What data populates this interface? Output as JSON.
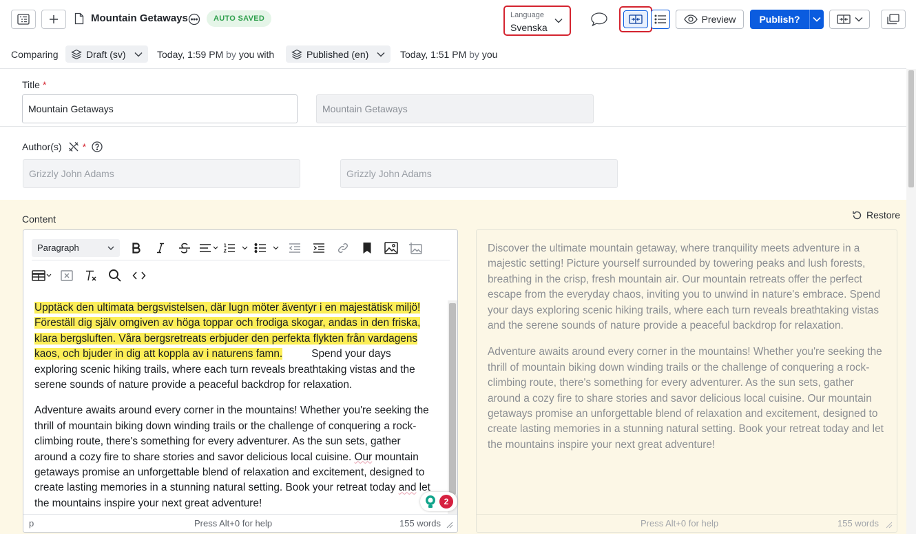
{
  "header": {
    "doc_title": "Mountain Getaways",
    "status_badge": "AUTO SAVED",
    "language": {
      "caption": "Language",
      "value": "Svenska"
    },
    "preview_label": "Preview",
    "publish_label": "Publish?",
    "icons": [
      "structure-icon",
      "plus-icon",
      "document-icon",
      "more-options-icon",
      "comment-icon",
      "compare-icon",
      "list-icon",
      "eye-icon",
      "layout-icon",
      "copy-icon"
    ]
  },
  "compare_bar": {
    "prefix": "Comparing",
    "left_version": "Draft (sv)",
    "left_time": "Today, 1:59 PM",
    "left_by_word": "by",
    "left_by_user": "you",
    "with_word": "with",
    "right_version": "Published (en)",
    "right_time": "Today, 1:51 PM",
    "right_by_word": "by",
    "right_by_user": "you"
  },
  "fields": {
    "title": {
      "label": "Title",
      "required_mark": "*",
      "value": "Mountain Getaways",
      "compare_value": "Mountain Getaways"
    },
    "authors": {
      "label": "Author(s)",
      "required_mark": "*",
      "value": "Grizzly John Adams",
      "compare_value": "Grizzly John Adams"
    },
    "content": {
      "label": "Content",
      "restore_label": "Restore"
    }
  },
  "editor": {
    "block_format": "Paragraph",
    "highlighted_text": "Upptäck den ultimata bergsvistelsen, där lugn möter äventyr i en majestätisk miljö! Föreställ dig själv omgiven av höga toppar och frodiga skogar, andas in den friska, klara bergsluften. Våra bergsretreats erbjuder den perfekta flykten från vardagens kaos, och bjuder in dig att koppla av i naturens famn.",
    "p1_rest": "Spend your days exploring scenic hiking trails, where each turn reveals breathtaking vistas and the serene sounds of nature provide a peaceful backdrop for relaxation.",
    "p2_a": "Adventure awaits around every corner in the mountains! Whether you're seeking the thrill of mountain biking down winding trails or the challenge of conquering a rock-climbing route, there's something for every adventurer. As the sun sets, gather around a cozy fire to share stories and savor delicious local cuisine.",
    "p2_our": "Our",
    "p2_b": "mountain getaways promise an unforgettable blend of relaxation and excitement, designed to create lasting memories in a stunning natural setting. Book your retreat today",
    "p2_and": "and",
    "p2_c": "let the mountains inspire your next great adventure!",
    "status_path": "p",
    "status_help": "Press Alt+0 for help",
    "status_words": "155 words",
    "assistant_count": "2"
  },
  "preview": {
    "p1": "Discover the ultimate mountain getaway, where tranquility meets adventure in a majestic setting! Picture yourself surrounded by towering peaks and lush forests, breathing in the crisp, fresh mountain air. Our mountain retreats offer the perfect escape from the everyday chaos, inviting you to unwind in nature's embrace. Spend your days exploring scenic hiking trails, where each turn reveals breathtaking vistas and the serene sounds of nature provide a peaceful backdrop for relaxation.",
    "p2": "Adventure awaits around every corner in the mountains! Whether you're seeking the thrill of mountain biking down winding trails or the challenge of conquering a rock-climbing route, there's something for every adventurer. As the sun sets, gather around a cozy fire to share stories and savor delicious local cuisine. Our mountain getaways promise an unforgettable blend of relaxation and excitement, designed to create lasting memories in a stunning natural setting. Book your retreat today and let the mountains inspire your next great adventure!",
    "status_help": "Press Alt+0 for help",
    "status_words": "155 words"
  },
  "colors": {
    "accent": "#0b5cdf",
    "highlight": "#fcee57",
    "required": "#d4232f",
    "success": "#2e9f4c",
    "content_bg": "#fdf8e6"
  }
}
